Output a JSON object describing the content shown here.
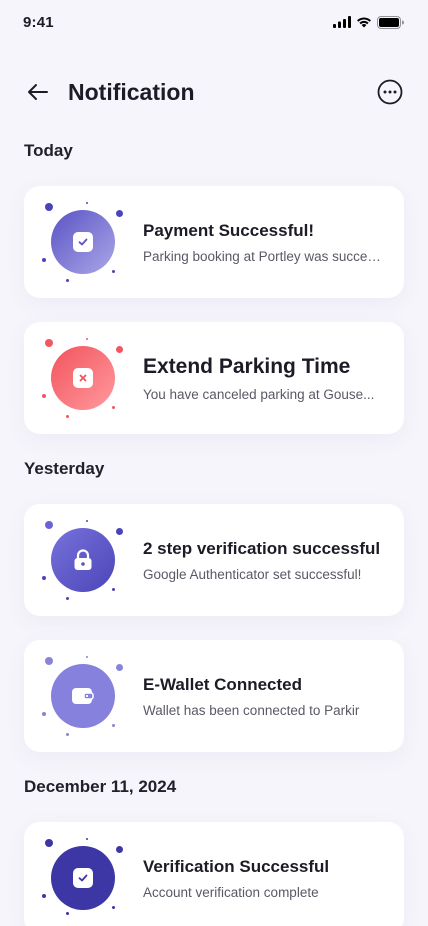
{
  "status_bar": {
    "time": "9:41"
  },
  "header": {
    "title": "Notification"
  },
  "sections": {
    "today": "Today",
    "yesterday": "Yesterday",
    "dec": "December 11, 2024"
  },
  "notifications": [
    {
      "title": "Payment Successful!",
      "desc": "Parking booking at Portley was successful",
      "icon": "check-icon",
      "color": "#6a63c9"
    },
    {
      "title": "Extend Parking Time",
      "desc": "You have canceled parking at Gouse...",
      "icon": "close-icon",
      "color": "#f45a62"
    },
    {
      "title": "2 step verification successful",
      "desc": "Google Authenticator set successful!",
      "icon": "lock-icon",
      "color": "#5b55c0"
    },
    {
      "title": "E-Wallet Connected",
      "desc": "Wallet has been connected to Parkir",
      "icon": "wallet-icon",
      "color": "#7e7ad6"
    },
    {
      "title": "Verification Successful",
      "desc": "Account verification complete",
      "icon": "check-icon",
      "color": "#3d37a6"
    }
  ]
}
